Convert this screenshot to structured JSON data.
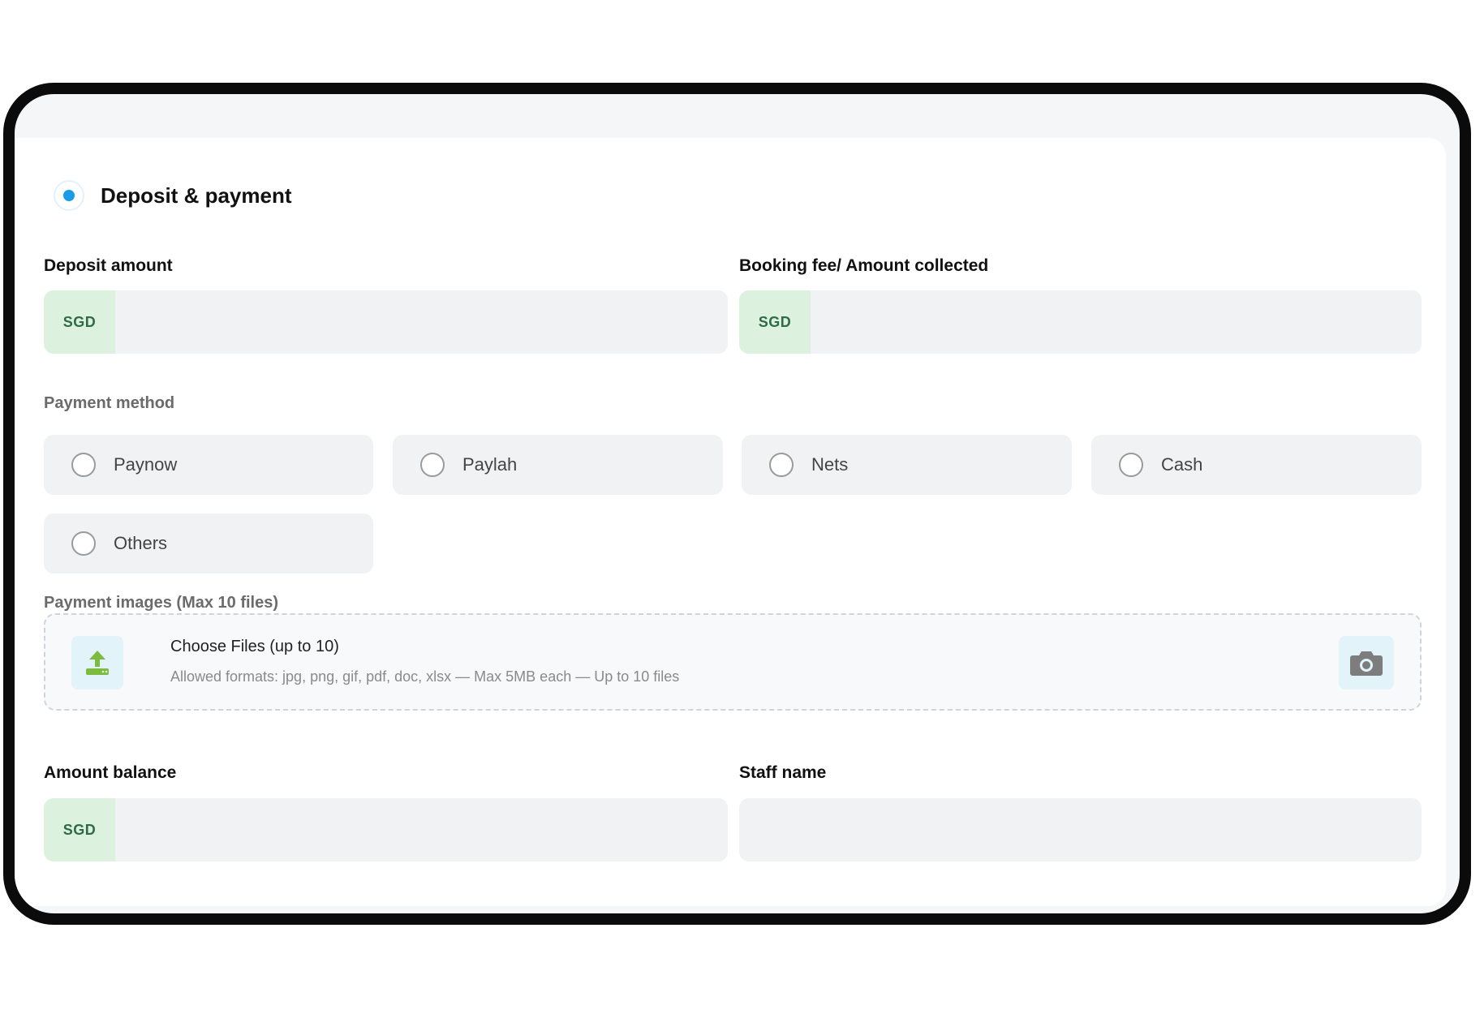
{
  "section": {
    "title": "Deposit & payment"
  },
  "deposit": {
    "label": "Deposit amount",
    "currency": "SGD",
    "value": ""
  },
  "booking_fee": {
    "label": "Booking fee/ Amount collected",
    "currency": "SGD",
    "value": ""
  },
  "payment_method": {
    "label": "Payment method",
    "options": [
      "Paynow",
      "Paylah",
      "Nets",
      "Cash",
      "Others"
    ]
  },
  "payment_images": {
    "label": "Payment images (Max 10 files)",
    "choose_label": "Choose Files (up to 10)",
    "hint": "Allowed formats: jpg, png, gif, pdf, doc, xlsx — Max 5MB each — Up to 10 files",
    "upload_icon": "upload-icon",
    "camera_icon": "camera-icon"
  },
  "amount_balance": {
    "label": "Amount balance",
    "currency": "SGD",
    "value": ""
  },
  "staff_name": {
    "label": "Staff name",
    "value": ""
  },
  "colors": {
    "accent": "#1a9be6",
    "currency_bg": "#dcf2df",
    "currency_text": "#2f6b44",
    "field_bg": "#f1f2f4"
  }
}
